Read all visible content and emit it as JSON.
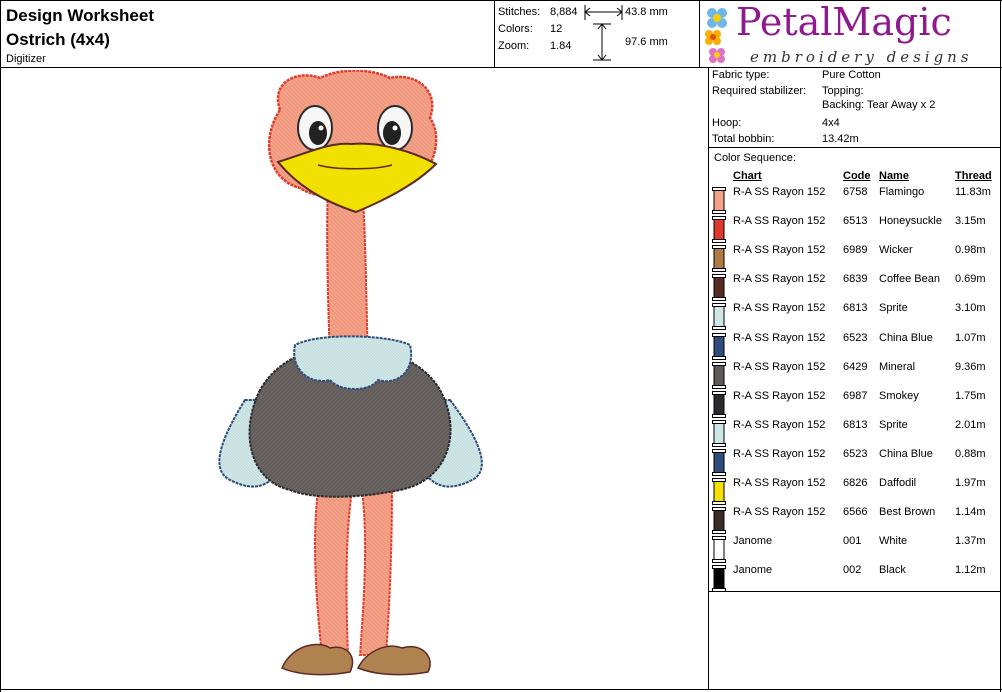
{
  "header": {
    "title": "Design Worksheet",
    "design_name": "Ostrich (4x4)",
    "digitizer_label": "Digitizer"
  },
  "stats": {
    "stitches_label": "Stitches:",
    "stitches": "8,884",
    "colors_label": "Colors:",
    "colors": "12",
    "zoom_label": "Zoom:",
    "zoom": "1.84",
    "width": "43.8 mm",
    "height": "97.6 mm"
  },
  "logo": {
    "brand": "PetalMagic",
    "tagline": "embroidery designs"
  },
  "info": {
    "fabric_label": "Fabric type:",
    "fabric": "Pure Cotton",
    "stabilizer_label": "Required stabilizer:",
    "topping": "Topping:",
    "backing": "Backing: Tear Away x 2",
    "hoop_label": "Hoop:",
    "hoop": "4x4",
    "bobbin_label": "Total bobbin:",
    "bobbin": "13.42m"
  },
  "color_sequence": {
    "label": "Color Sequence:",
    "columns": {
      "chart": "Chart",
      "code": "Code",
      "name": "Name",
      "thread": "Thread"
    },
    "rows": [
      {
        "chart": "R-A SS Rayon 152",
        "code": "6758",
        "name": "Flamingo",
        "thread": "11.83m",
        "color": "#f4a187"
      },
      {
        "chart": "R-A SS Rayon 152",
        "code": "6513",
        "name": "Honeysuckle",
        "thread": "3.15m",
        "color": "#e0392b"
      },
      {
        "chart": "R-A SS Rayon 152",
        "code": "6989",
        "name": "Wicker",
        "thread": "0.98m",
        "color": "#b07a45"
      },
      {
        "chart": "R-A SS Rayon 152",
        "code": "6839",
        "name": "Coffee Bean",
        "thread": "0.69m",
        "color": "#5a2a25"
      },
      {
        "chart": "R-A SS Rayon 152",
        "code": "6813",
        "name": "Sprite",
        "thread": "3.10m",
        "color": "#cfe6e6"
      },
      {
        "chart": "R-A SS Rayon 152",
        "code": "6523",
        "name": "China Blue",
        "thread": "1.07m",
        "color": "#2f4c7e"
      },
      {
        "chart": "R-A SS Rayon 152",
        "code": "6429",
        "name": "Mineral",
        "thread": "9.36m",
        "color": "#5f5a58"
      },
      {
        "chart": "R-A SS Rayon 152",
        "code": "6987",
        "name": "Smokey",
        "thread": "1.75m",
        "color": "#2b2a2e"
      },
      {
        "chart": "R-A SS Rayon 152",
        "code": "6813",
        "name": "Sprite",
        "thread": "2.01m",
        "color": "#cfe6e6"
      },
      {
        "chart": "R-A SS Rayon 152",
        "code": "6523",
        "name": "China Blue",
        "thread": "0.88m",
        "color": "#2f4c7e"
      },
      {
        "chart": "R-A SS Rayon 152",
        "code": "6826",
        "name": "Daffodil",
        "thread": "1.97m",
        "color": "#f5e000"
      },
      {
        "chart": "R-A SS Rayon 152",
        "code": "6566",
        "name": "Best Brown",
        "thread": "1.14m",
        "color": "#3a2b24"
      },
      {
        "chart": "Janome",
        "code": "001",
        "name": "White",
        "thread": "1.37m",
        "color": "#ffffff"
      },
      {
        "chart": "Janome",
        "code": "002",
        "name": "Black",
        "thread": "1.12m",
        "color": "#000000"
      }
    ]
  }
}
